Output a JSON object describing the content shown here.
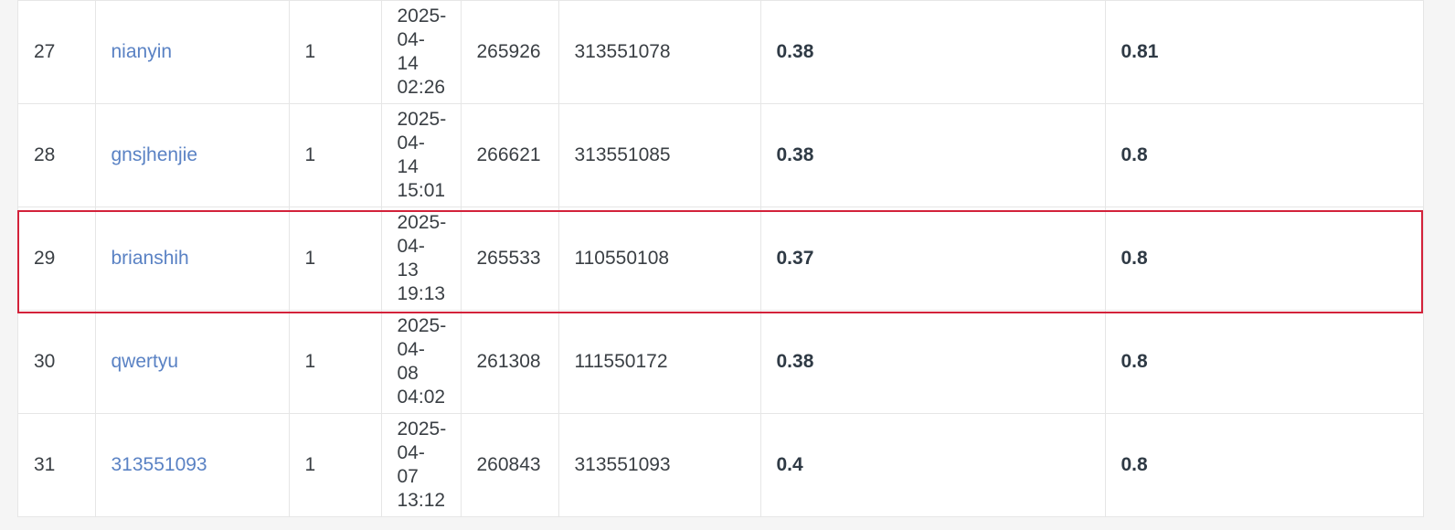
{
  "leaderboard": {
    "rows": [
      {
        "rank": "27",
        "team": "nianyin",
        "entries": "1",
        "date": [
          "2025-",
          "04-14",
          "02:26"
        ],
        "id1": "265926",
        "id2": "313551078",
        "score1": "0.38",
        "score2": "0.81"
      },
      {
        "rank": "28",
        "team": "gnsjhenjie",
        "entries": "1",
        "date": [
          "2025-",
          "04-14",
          "15:01"
        ],
        "id1": "266621",
        "id2": "313551085",
        "score1": "0.38",
        "score2": "0.8"
      },
      {
        "rank": "29",
        "team": "brianshih",
        "entries": "1",
        "date": [
          "2025-",
          "04-13",
          "19:13"
        ],
        "id1": "265533",
        "id2": "110550108",
        "score1": "0.37",
        "score2": "0.8"
      },
      {
        "rank": "30",
        "team": "qwertyu",
        "entries": "1",
        "date": [
          "2025-",
          "04-08",
          "04:02"
        ],
        "id1": "261308",
        "id2": "111550172",
        "score1": "0.38",
        "score2": "0.8"
      },
      {
        "rank": "31",
        "team": "313551093",
        "entries": "1",
        "date": [
          "2025-",
          "04-07",
          "13:12"
        ],
        "id1": "260843",
        "id2": "313551093",
        "score1": "0.4",
        "score2": "0.8"
      }
    ],
    "highlighted_rank": "29",
    "highlight_color": "#d3223a",
    "link_color": "#5a82c4"
  }
}
